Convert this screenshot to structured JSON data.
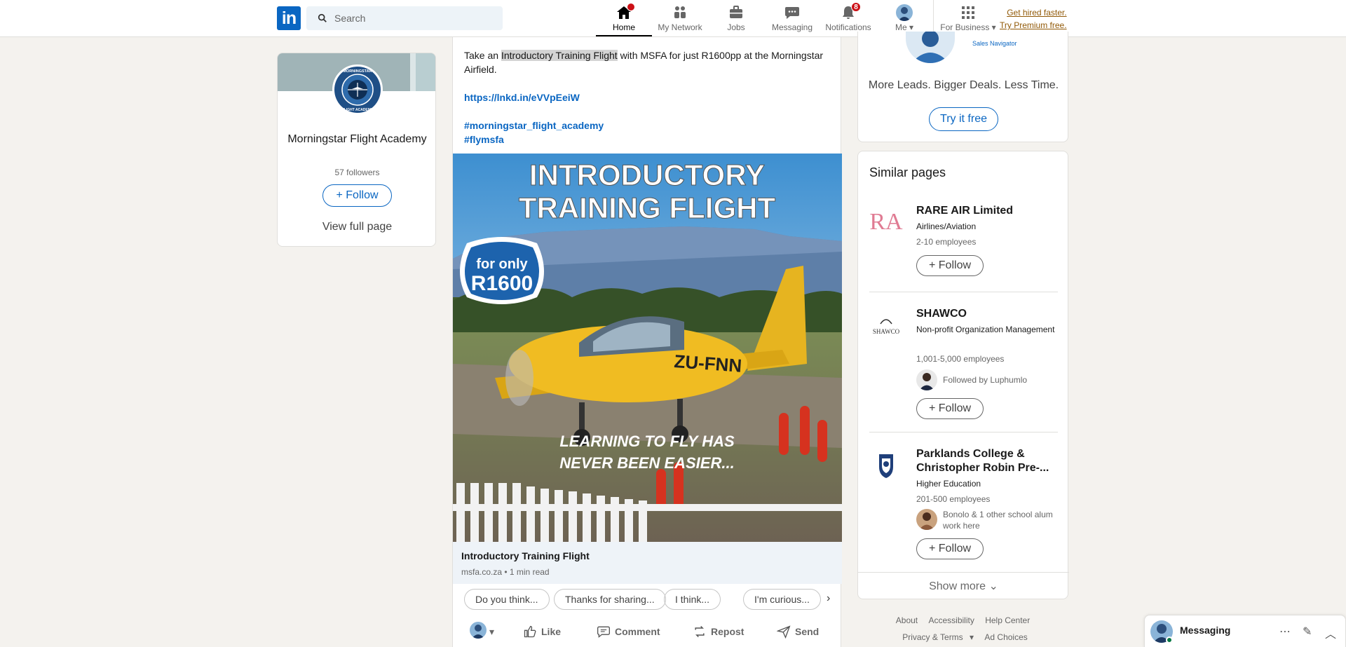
{
  "nav": {
    "search_placeholder": "Search",
    "items": [
      {
        "label": "Home",
        "icon": "home-icon",
        "badge": ""
      },
      {
        "label": "My Network",
        "icon": "network-icon",
        "badge": ""
      },
      {
        "label": "Jobs",
        "icon": "briefcase-icon",
        "badge": ""
      },
      {
        "label": "Messaging",
        "icon": "chat-icon",
        "badge": ""
      },
      {
        "label": "Notifications",
        "icon": "bell-icon",
        "badge": "8"
      },
      {
        "label": "Me",
        "icon": "avatar",
        "badge": ""
      },
      {
        "label": "For Business",
        "icon": "grid-icon",
        "badge": ""
      }
    ],
    "premium_line1": "Get hired faster.",
    "premium_line2": "Try Premium free."
  },
  "company_card": {
    "name": "Morningstar Flight Academy",
    "followers": "57 followers",
    "follow_label": "Follow",
    "view_full": "View full page",
    "logo_text": "MORNINGSTAR FLIGHT ACADEMY"
  },
  "post": {
    "text_before": "Take an ",
    "text_highlight": "Introductory Training Flight",
    "text_after": " with MSFA for just R1600pp at the Morningstar Airfield.",
    "link": "https://lnkd.in/eVVpEeiW",
    "hashtag1": "#morningstar_flight_academy",
    "hashtag2": "#flymsfa",
    "image": {
      "headline1": "INTRODUCTORY",
      "headline2": "TRAINING FLIGHT",
      "badge1": "for only",
      "badge2": "R1600",
      "reg": "ZU-FNN",
      "tagline1": "LEARNING TO FLY HAS",
      "tagline2": "NEVER BEEN EASIER..."
    },
    "article_title": "Introductory Training Flight",
    "article_source": "msfa.co.za • 1 min read",
    "chips": [
      "Do you think...",
      "Thanks for sharing...",
      "I think...",
      "I'm curious..."
    ],
    "actions": {
      "like": "Like",
      "comment": "Comment",
      "repost": "Repost",
      "send": "Send"
    }
  },
  "promo": {
    "product": "Sales Navigator",
    "tagline": "More Leads. Bigger Deals. Less Time.",
    "cta": "Try it free"
  },
  "similar_pages": {
    "heading": "Similar pages",
    "items": [
      {
        "name": "RARE AIR Limited",
        "industry": "Airlines/Aviation",
        "employees": "2-10 employees",
        "followed_by": "",
        "logo_text": "RA"
      },
      {
        "name": "SHAWCO",
        "industry": "Non-profit Organization Management",
        "employees": "1,001-5,000 employees",
        "followed_by": "Followed by Luphumlo",
        "logo_text": "SHAWCO"
      },
      {
        "name": "Parklands College & Christopher Robin Pre-...",
        "industry": "Higher Education",
        "employees": "201-500 employees",
        "followed_by": "Bonolo & 1 other school alum work here",
        "logo_text": ""
      }
    ],
    "follow_label": "Follow",
    "show_more": "Show more"
  },
  "footer": {
    "links": [
      "About",
      "Accessibility",
      "Help Center"
    ],
    "links2": [
      "Privacy & Terms",
      "Ad Choices"
    ]
  },
  "messaging": {
    "label": "Messaging"
  },
  "colors": {
    "brand": "#0a66c2",
    "premium": "#915907",
    "badge": "#cc1016"
  }
}
